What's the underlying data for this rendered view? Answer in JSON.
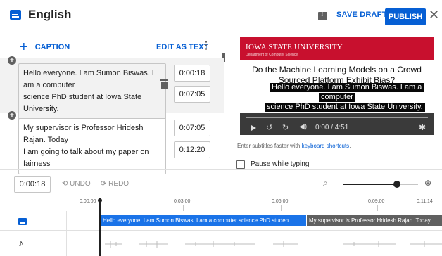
{
  "header": {
    "language": "English",
    "save_draft": "SAVE DRAFT",
    "publish": "PUBLISH",
    "close": "✕"
  },
  "editor": {
    "add_caption": "CAPTION",
    "add_caption_symbol": "+",
    "edit_as_text": "EDIT AS TEXT",
    "cues": [
      {
        "text_lines": [
          "Hello everyone. I am Sumon Biswas. I",
          "am a computer",
          "science PhD student at Iowa State",
          "University."
        ],
        "start": "0:00:18",
        "end": "0:07:05"
      },
      {
        "text_lines": [
          "My supervisor is Professor Hridesh",
          "Rajan. Today",
          "I am going to talk about my paper on",
          "fairness"
        ],
        "start": "0:07:05",
        "end": "0:12:20"
      }
    ]
  },
  "video": {
    "university": "IOWA STATE UNIVERSITY",
    "department": "Department of Computer Science",
    "title_line1": "Do the Machine Learning Models on a Crowd",
    "title_line2": "Sourced Platform Exhibit Bias?",
    "caption_line1": "Hello everyone. I am Sumon Biswas. I am a",
    "caption_line2": "computer",
    "caption_line3": "science PhD student at Iowa State University.",
    "time": "0:00 / 4:51"
  },
  "hint": {
    "text": "Enter subtitles faster with ",
    "link": "keyboard shortcuts",
    "end": "."
  },
  "pause_while_typing": "Pause while typing",
  "toolbar": {
    "current_time": "0:00:18",
    "undo": "UNDO",
    "redo": "REDO",
    "zoom_level": 0.72
  },
  "timeline": {
    "ticks": [
      "0:00:00",
      "0:03:00",
      "0:06:00",
      "0:09:00",
      "0:11:14"
    ],
    "segment1": "Hello everyone. I am Sumon Biswas. I am a computer  science PhD studen...",
    "segment2": "My supervisor is Professor Hridesh Rajan. Today"
  },
  "colors": {
    "accent": "#065fd4",
    "isu_red": "#c8102e"
  }
}
